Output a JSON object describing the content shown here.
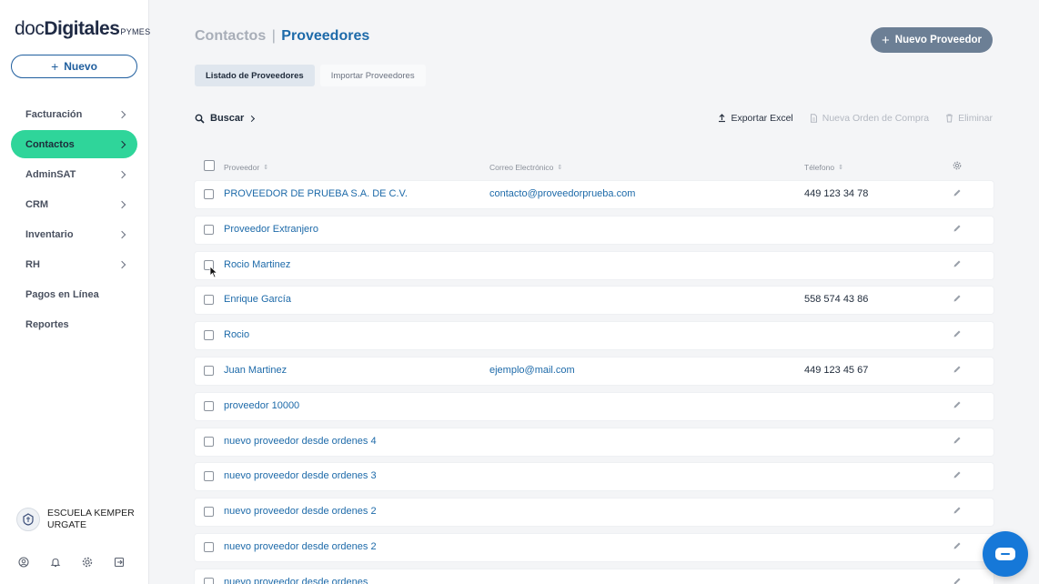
{
  "brand": {
    "part1": "doc",
    "part2": "Digitales",
    "part3": "PYMES"
  },
  "sidebar": {
    "new_label": "Nuevo",
    "items": [
      {
        "label": "Facturación",
        "has_chevron": true
      },
      {
        "label": "Contactos",
        "has_chevron": true,
        "active": true
      },
      {
        "label": "AdminSAT",
        "has_chevron": true
      },
      {
        "label": "CRM",
        "has_chevron": true
      },
      {
        "label": "Inventario",
        "has_chevron": true
      },
      {
        "label": "RH",
        "has_chevron": true
      },
      {
        "label": "Pagos en Línea",
        "has_chevron": false
      },
      {
        "label": "Reportes",
        "has_chevron": false
      }
    ],
    "org": {
      "name": "ESCUELA KEMPER URGATE"
    },
    "bottom_icons": [
      "user-circle-icon",
      "bell-icon",
      "gear-icon",
      "logout-icon"
    ]
  },
  "header": {
    "breadcrumb_parent": "Contactos",
    "breadcrumb_sep": "|",
    "breadcrumb_current": "Proveedores",
    "primary_button": "Nuevo Proveedor"
  },
  "tabs": [
    {
      "label": "Listado de Proveedores",
      "active": true
    },
    {
      "label": "Importar Proveedores",
      "active": false
    }
  ],
  "toolbar": {
    "search_label": "Buscar",
    "export_label": "Exportar Excel",
    "purchase_order_label": "Nueva Orden de Compra",
    "delete_label": "Eliminar"
  },
  "table": {
    "columns": [
      "Proveedor",
      "Correo Electrónico",
      "Télefono"
    ],
    "rows": [
      {
        "name": "PROVEEDOR DE PRUEBA S.A. DE C.V.",
        "email": "contacto@proveedorprueba.com",
        "phone": "449 123 34 78"
      },
      {
        "name": "Proveedor Extranjero",
        "email": "",
        "phone": ""
      },
      {
        "name": "Rocio Martinez",
        "email": "",
        "phone": ""
      },
      {
        "name": "Enrique García",
        "email": "",
        "phone": "558 574 43 86"
      },
      {
        "name": "Rocio",
        "email": "",
        "phone": ""
      },
      {
        "name": "Juan Martinez",
        "email": "ejemplo@mail.com",
        "phone": "449 123 45 67"
      },
      {
        "name": "proveedor 10000",
        "email": "",
        "phone": ""
      },
      {
        "name": "nuevo proveedor desde ordenes 4",
        "email": "",
        "phone": ""
      },
      {
        "name": "nuevo proveedor desde ordenes 3",
        "email": "",
        "phone": ""
      },
      {
        "name": "nuevo proveedor desde ordenes 2",
        "email": "",
        "phone": ""
      },
      {
        "name": "nuevo proveedor desde ordenes 2",
        "email": "",
        "phone": ""
      },
      {
        "name": "nuevo proveedor desde ordenes",
        "email": "",
        "phone": ""
      }
    ]
  },
  "colors": {
    "accent": "#2fd59a",
    "link": "#1d6aa9",
    "primary_button": "#6c7f95",
    "chat": "#1678d8"
  }
}
